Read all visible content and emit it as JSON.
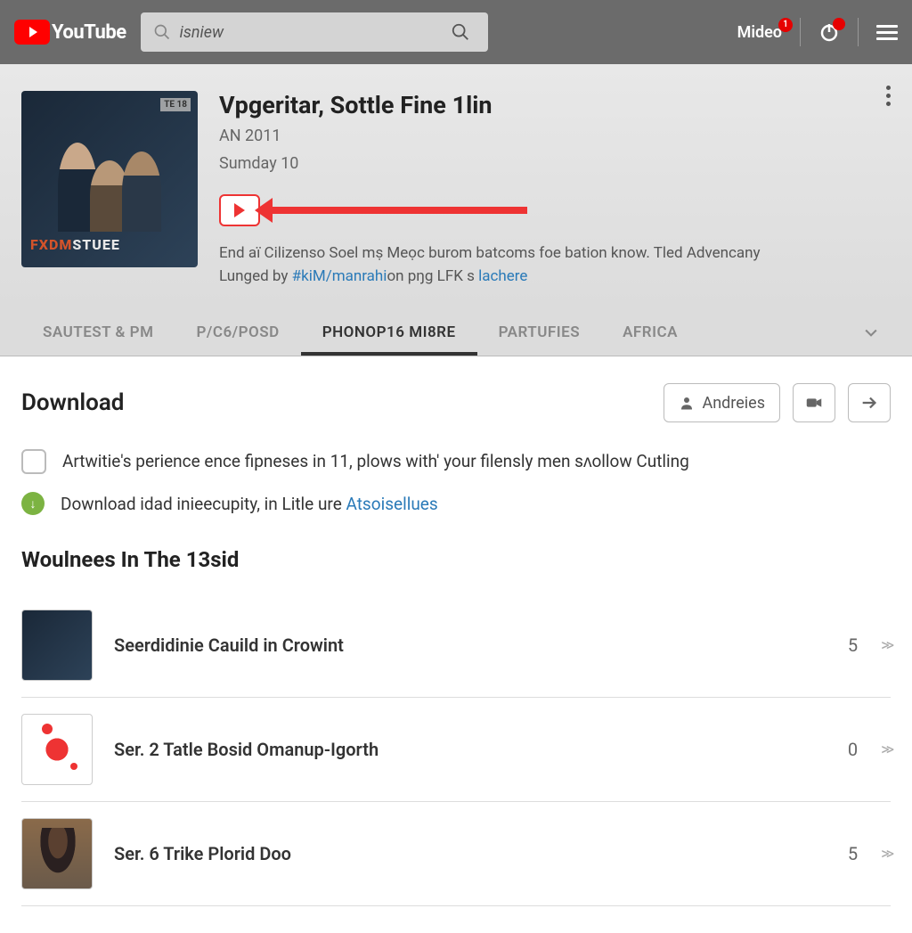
{
  "header": {
    "logo_text": "YouTube",
    "search_value": "isniew",
    "mideo_label": "Mideo",
    "mideo_badge": "1"
  },
  "hero": {
    "title": "Vpgeritar, Sottle Fine 1lin",
    "sub1": "AN 2011",
    "sub2": "Sumday 10",
    "poster_badge": "TE 18",
    "poster_text1": "FXDM",
    "poster_text2": "STUEE",
    "desc_line1_a": "End aï Cilizenso Soel mṣ Meọc burom batcoms foe bation know. Tled Advencany",
    "desc_line2_a": "Lunged by ",
    "desc_link1": "#kiM/manrahi",
    "desc_line2_b": "on pŋg LFK s ",
    "desc_link2": "lachere"
  },
  "tabs": {
    "items": [
      {
        "label": "SAUTEST & PM"
      },
      {
        "label": "P/C6/POSD"
      },
      {
        "label": "PHONOP16 MI8RE"
      },
      {
        "label": "PARTUFIES"
      },
      {
        "label": "AFRICA"
      }
    ],
    "active_index": 2
  },
  "download": {
    "title": "Download",
    "btn_label": "Andreies",
    "check_text": "Artwitie's perience ence fipneses in 11, plows with' your filensly men sʌollow Cutling",
    "dl_text_a": "Download idad inieecupity, in Litle ure ",
    "dl_link": "Atsoisellues"
  },
  "list": {
    "title": "Woulnees In The 13sid",
    "items": [
      {
        "title": "Seerdidinie Cauild in Crowint",
        "count": "5"
      },
      {
        "title": "Ser. 2 Tatle Bosid Omanup-Igorth",
        "count": "0"
      },
      {
        "title": "Ser. 6 Trike Plorid Doo",
        "count": "5"
      }
    ]
  }
}
